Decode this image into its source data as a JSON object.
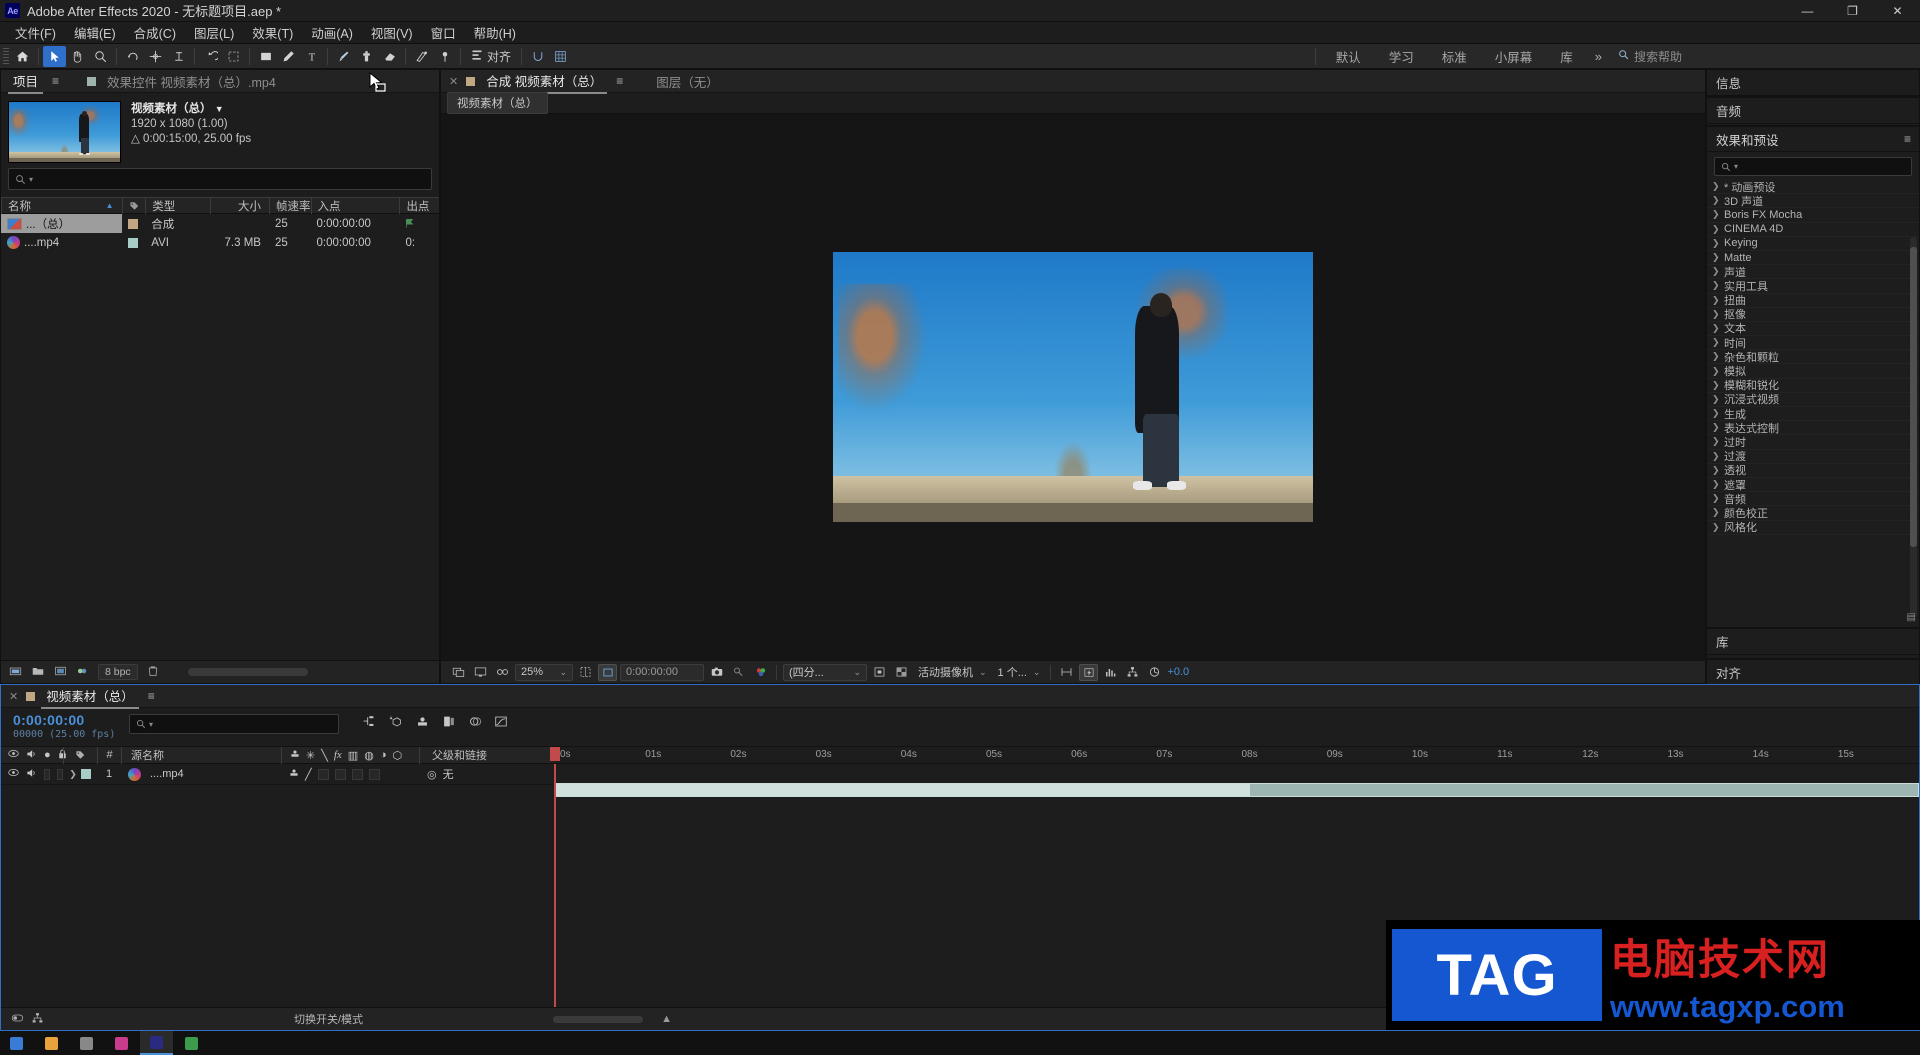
{
  "window": {
    "title": "Adobe After Effects 2020 - 无标题项目.aep *",
    "logo": "Ae",
    "minimize": "—",
    "maximize": "❐",
    "close": "✕"
  },
  "menubar": {
    "items": [
      "文件(F)",
      "编辑(E)",
      "合成(C)",
      "图层(L)",
      "效果(T)",
      "动画(A)",
      "视图(V)",
      "窗口",
      "帮助(H)"
    ]
  },
  "toolbar": {
    "align_label": "对齐",
    "workspaces": [
      "默认",
      "学习",
      "标准",
      "小屏幕",
      "库"
    ],
    "more": "»",
    "search_placeholder": "搜索帮助"
  },
  "project": {
    "tab_label": "项目",
    "effects_controls_tab": "效果控件 视频素材（总）.mp4",
    "item": {
      "name": "视频素材（总）",
      "dimensions": "1920 x 1080 (1.00)",
      "duration": "0:00:15:00, 25.00 fps"
    },
    "search_placeholder": "",
    "columns": [
      "名称",
      "类型",
      "大小",
      "帧速率",
      "入点",
      "出点"
    ],
    "rows": [
      {
        "name": "...（总）",
        "type": "合成",
        "size": "",
        "rate": "25",
        "in": "0:00:00:00",
        "out": ""
      },
      {
        "name": "....mp4",
        "type": "AVI",
        "size": "7.3 MB",
        "rate": "25",
        "in": "0:00:00:00",
        "out": "0:"
      }
    ],
    "footer_bpc": "8 bpc"
  },
  "composition": {
    "tab_label": "合成 视频素材（总）",
    "layer_tab": "图层（无）",
    "breadcrumb": "视频素材（总）",
    "zoom": "25%",
    "time": "0:00:00:00",
    "resolution": "(四分...",
    "camera": "活动摄像机",
    "views": "1 个...",
    "exposure": "+0.0"
  },
  "right_panels": {
    "info": "信息",
    "audio": "音频",
    "effects_title": "效果和预设",
    "effects_menu": "≡",
    "effects_search_placeholder": "",
    "effects": [
      "* 动画预设",
      "3D 声道",
      "Boris FX Mocha",
      "CINEMA 4D",
      "Keying",
      "Matte",
      "声道",
      "实用工具",
      "扭曲",
      "抠像",
      "文本",
      "时间",
      "杂色和颗粒",
      "模拟",
      "模糊和锐化",
      "沉浸式视频",
      "生成",
      "表达式控制",
      "过时",
      "过渡",
      "透视",
      "遮罩",
      "音频",
      "颜色校正",
      "风格化"
    ],
    "library": "库",
    "align": "对齐"
  },
  "timeline": {
    "tab_label": "视频素材（总）",
    "current_time": "0:00:00:00",
    "frame_info": "00000 (25.00 fps)",
    "search_placeholder": "",
    "columns": {
      "source_name": "源名称",
      "parent": "父级和链接",
      "number": "#"
    },
    "layers": [
      {
        "index": "1",
        "name": "....mp4",
        "parent": "无"
      }
    ],
    "ruler_ticks": [
      "0s",
      "01s",
      "02s",
      "03s",
      "04s",
      "05s",
      "06s",
      "07s",
      "08s",
      "09s",
      "10s",
      "11s",
      "12s",
      "13s",
      "14s",
      "15s"
    ],
    "footer_toggle": "切换开关/模式"
  },
  "watermark": {
    "tag": "TAG",
    "site_cn": "电脑技术网",
    "url": "www.tagxp.com"
  },
  "icons": {
    "home": "⌂",
    "selection": "➤",
    "hand": "✋",
    "zoom": "🔍",
    "rotation": "↻",
    "camera": "⊕",
    "anchor": "⌖",
    "shape": "▭",
    "pen": "✎",
    "text": "T",
    "brush": "🖌",
    "clone": "⎘",
    "eraser": "◧",
    "roto": "✂",
    "puppet": "📌",
    "search": "⌕",
    "eye": "◉",
    "audio": "◐",
    "lock": "🔒",
    "tag": "🏷"
  },
  "taskbar": {
    "items": [
      "",
      "",
      "",
      "",
      "",
      ""
    ]
  }
}
